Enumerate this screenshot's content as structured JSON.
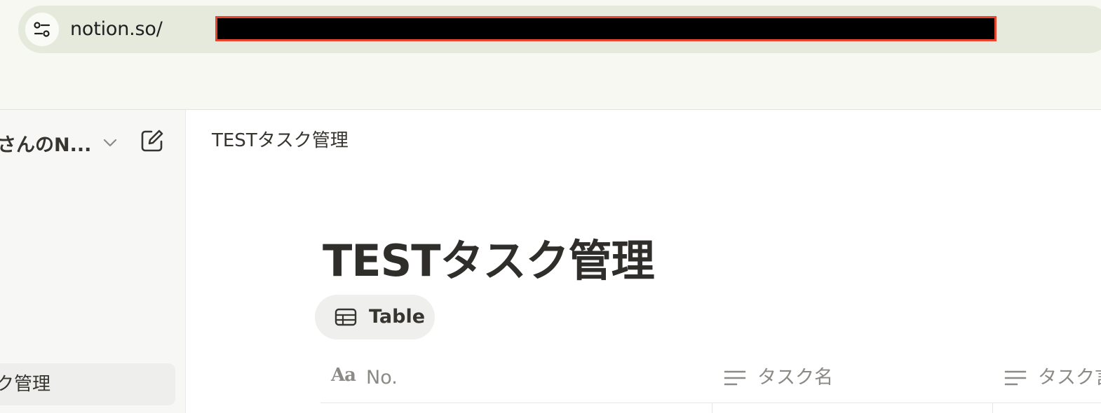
{
  "browser": {
    "url_prefix": "notion.so/",
    "url_redacted": true
  },
  "sidebar": {
    "workspace_name": "さんのN...",
    "items": [
      {
        "label": "ク管理",
        "selected": true
      }
    ]
  },
  "topbar": {
    "breadcrumb": "TESTタスク管理"
  },
  "page": {
    "title": "TESTタスク管理",
    "views": [
      {
        "label": "Table",
        "icon": "table-icon",
        "active": true
      }
    ],
    "table": {
      "columns": [
        {
          "label": "No.",
          "icon": "title-type-icon"
        },
        {
          "label": "タスク名",
          "icon": "text-type-icon"
        },
        {
          "label": "タスク言",
          "icon": "text-type-icon"
        }
      ]
    }
  },
  "colors": {
    "redaction_border": "#e8442e",
    "chrome_bg": "#f7f8f2",
    "urlbar_bg": "#e6eadd",
    "sidebar_bg": "#f7f7f5",
    "text": "#37352f",
    "muted_text": "#8b8a86"
  }
}
